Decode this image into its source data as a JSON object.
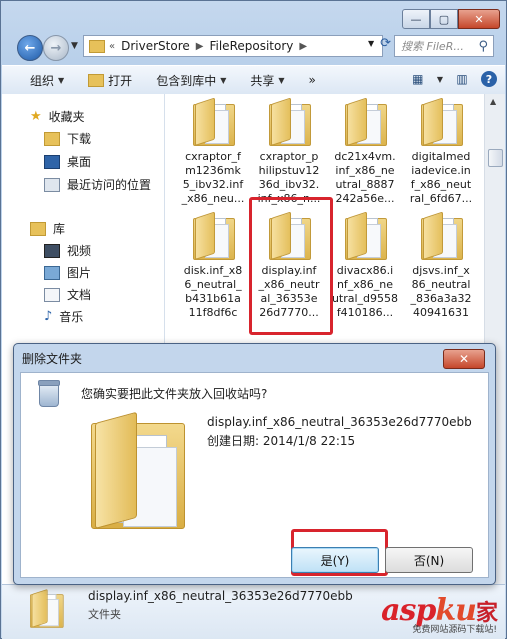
{
  "window": {
    "caption_buttons": {
      "minimize": "—",
      "maximize": "▢",
      "close": "✕"
    }
  },
  "address_bar": {
    "prefix": "«",
    "crumbs": [
      "DriverStore",
      "FileRepository"
    ],
    "search_placeholder": "搜索 FileR..."
  },
  "toolbar": {
    "organize": "组织",
    "open": "打开",
    "include_in_library": "包含到库中",
    "share": "共享",
    "more": "»"
  },
  "nav": {
    "favorites": "收藏夹",
    "downloads": "下载",
    "desktop": "桌面",
    "recent": "最近访问的位置",
    "libraries": "库",
    "videos": "视频",
    "pictures": "图片",
    "documents": "文档",
    "music": "音乐"
  },
  "files": [
    {
      "label": "cxraptor_f\nm1236mk\n5_ibv32.inf\n_x86_neu..."
    },
    {
      "label": "cxraptor_p\nhilipstuv12\n36d_ibv32.\ninf_x86_n..."
    },
    {
      "label": "dc21x4vm.\ninf_x86_ne\nutral_8887\n242a56e..."
    },
    {
      "label": "digitalmed\niadevice.in\nf_x86_neut\nral_6fd67..."
    },
    {
      "label": "disk.inf_x8\n6_neutral_\nb431b61a\n11f8df6c"
    },
    {
      "label": "display.inf\n_x86_neutr\nal_36353e\n26d7770..."
    },
    {
      "label": "divacx86.i\nnf_x86_ne\nutral_d9558\nf410186..."
    },
    {
      "label": "djsvs.inf_x\n86_neutral\n_836a3a32\n40941631"
    }
  ],
  "dialog": {
    "title": "删除文件夹",
    "close": "✕",
    "question": "您确实要把此文件夹放入回收站吗?",
    "folder_name": "display.inf_x86_neutral_36353e26d7770ebb",
    "created_label": "创建日期:",
    "created_date": "2014/1/8 22:15",
    "yes": "是(Y)",
    "no": "否(N)"
  },
  "status": {
    "name": "display.inf_x86_neutral_36353e26d7770ebb",
    "type": "文件夹"
  },
  "watermark": {
    "brand_a": "asp",
    "brand_b": "ku",
    "brand_c": "家",
    "tagline": "免费网站源码下载站!"
  },
  "colors": {
    "highlight_red": "#d8242d",
    "window_frame": "#c5d8ee"
  }
}
